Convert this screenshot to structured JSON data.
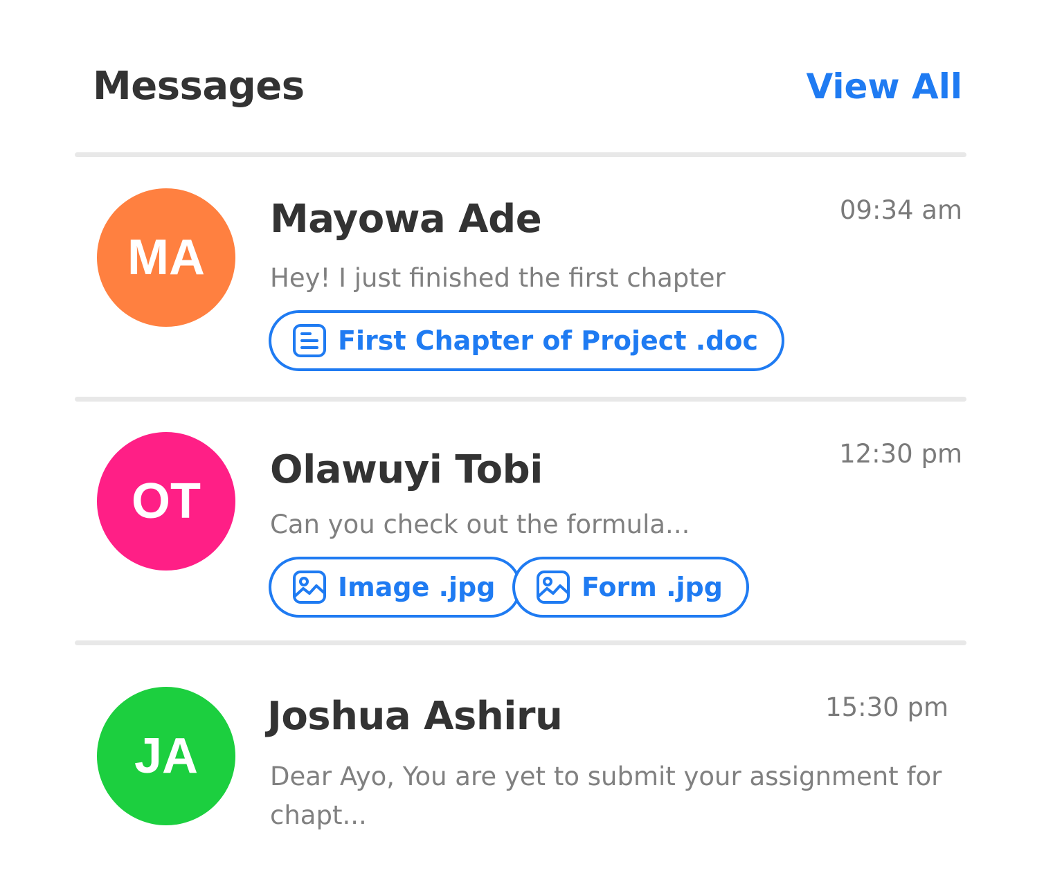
{
  "header": {
    "title": "Messages",
    "view_all_label": "View All"
  },
  "colors": {
    "accent": "#1f7bf2",
    "text_dark": "#333333",
    "text_muted": "#808080",
    "divider": "#e8e8e8"
  },
  "messages": [
    {
      "initials": "MA",
      "avatar_color": "#ff8040",
      "name": "Mayowa Ade",
      "time": "09:34 am",
      "preview": "Hey! I just finished the first chapter",
      "attachments": [
        {
          "label": "First Chapter of Project .doc",
          "icon": "document-icon"
        }
      ]
    },
    {
      "initials": "OT",
      "avatar_color": "#ff1f86",
      "name": "Olawuyi Tobi",
      "time": "12:30 pm",
      "preview": "Can you check out the formula...",
      "attachments": [
        {
          "label": "Image .jpg",
          "icon": "image-icon"
        },
        {
          "label": "Form .jpg",
          "icon": "image-icon"
        }
      ]
    },
    {
      "initials": "JA",
      "avatar_color": "#1ccf3f",
      "name": "Joshua Ashiru",
      "time": "15:30 pm",
      "preview": "Dear Ayo, You are yet to submit your assignment for chapt...",
      "attachments": []
    }
  ]
}
